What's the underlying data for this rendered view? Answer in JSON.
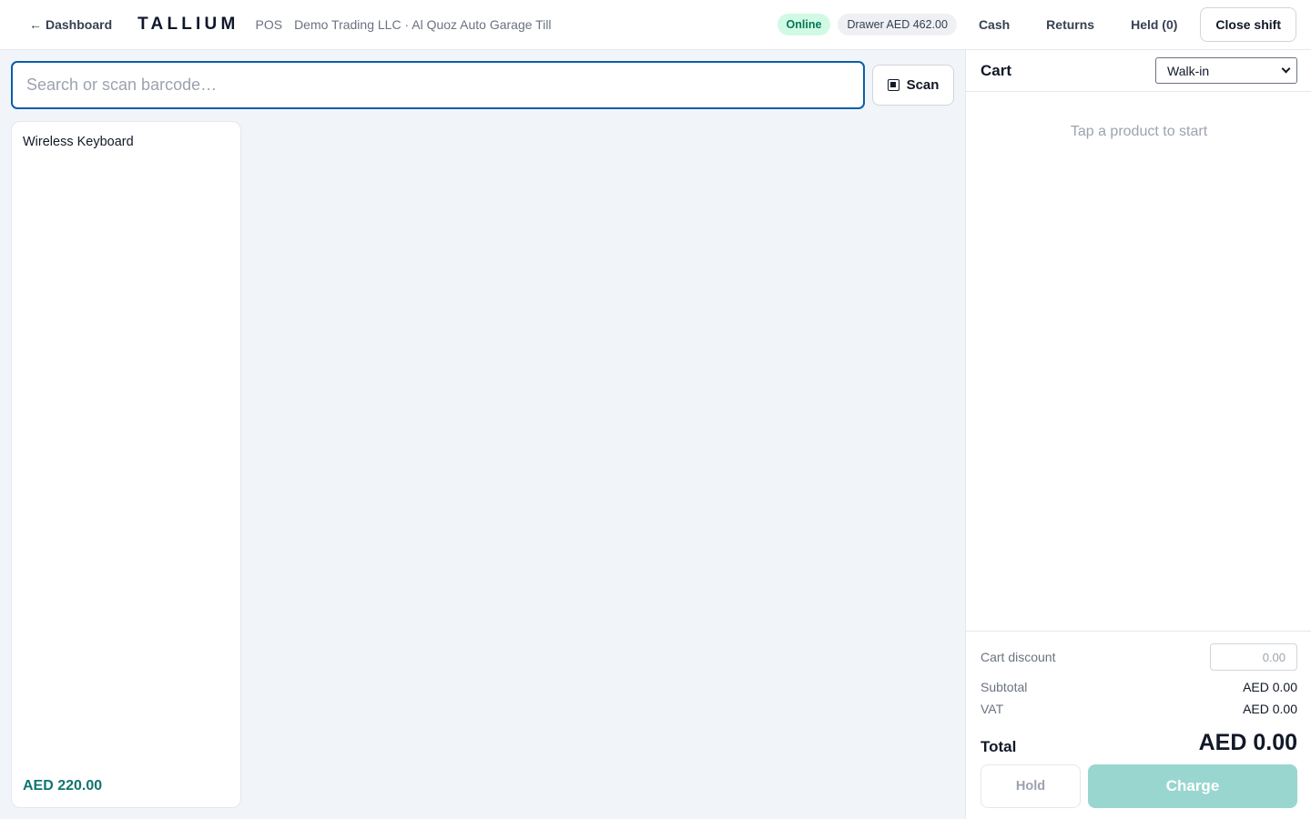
{
  "topbar": {
    "back_label": "Dashboard",
    "back_icon": "arrow-left-icon",
    "brand": "TALLIUM",
    "mode": "POS",
    "context": "Demo Trading LLC · Al Quoz Auto Garage Till",
    "status": "Online",
    "drawer": "Drawer AED 462.00",
    "nav": [
      "Cash",
      "Returns",
      "Held (0)"
    ],
    "close_shift": "Close shift"
  },
  "search": {
    "placeholder": "Search or scan barcode…",
    "value": "",
    "scan_label": "Scan",
    "scan_icon": "barcode-scan-icon"
  },
  "products": [
    {
      "name": "Wireless Keyboard",
      "price": "AED 220.00"
    }
  ],
  "cart": {
    "title": "Cart",
    "customer": "Walk-in",
    "empty_message": "Tap a product to start",
    "discount_label": "Cart discount",
    "discount_placeholder": "0.00",
    "subtotal_label": "Subtotal",
    "subtotal_value": "AED 0.00",
    "vat_label": "VAT",
    "vat_value": "AED 0.00",
    "total_label": "Total",
    "total_value": "AED 0.00",
    "hold_label": "Hold",
    "charge_label": "Charge"
  },
  "colors": {
    "accent": "#0f766e",
    "focus_border": "#0b5ea8",
    "online_bg": "#d1fae5",
    "online_text": "#047857",
    "charge_disabled": "#99d6cf"
  }
}
